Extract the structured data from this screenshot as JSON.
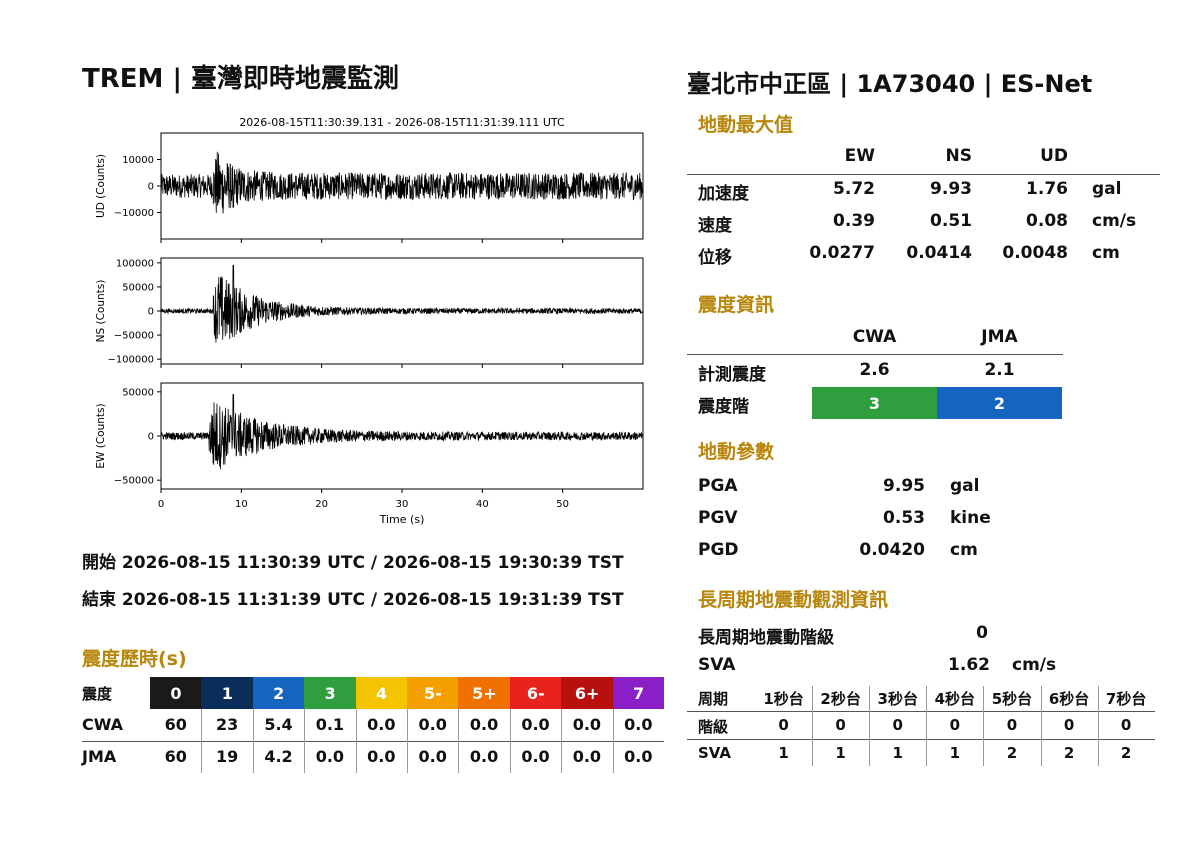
{
  "header": {
    "title": "TREM | 臺灣即時地震監測",
    "station": "臺北市中正區 | 1A73040 | ES-Net"
  },
  "chart_data": {
    "type": "line",
    "title": "2026-08-15T11:30:39.131 - 2026-08-15T11:31:39.111 UTC",
    "xlabel": "Time (s)",
    "xlim": [
      0,
      60
    ],
    "xticks": [
      0,
      10,
      20,
      30,
      40,
      50
    ],
    "series": [
      {
        "name": "UD",
        "ylabel": "UD (Counts)",
        "ylim": [
          -20000,
          20000
        ],
        "yticks": [
          10000,
          0,
          -10000
        ],
        "ytick_labels": [
          "10000",
          "0",
          "−10000"
        ],
        "peak": 16000,
        "onset": 6.5,
        "tail": 0.32,
        "decay": 0.5,
        "noise": 0.28
      },
      {
        "name": "NS",
        "ylabel": "NS (Counts)",
        "ylim": [
          -110000,
          110000
        ],
        "yticks": [
          100000,
          50000,
          0,
          -50000,
          -100000
        ],
        "ytick_labels": [
          "100000",
          "50000",
          "0",
          "−50000",
          "−100000"
        ],
        "peak": 95000,
        "onset": 6.5,
        "tail": 0.06,
        "decay": 0.22,
        "noise": 0.05
      },
      {
        "name": "EW",
        "ylabel": "EW (Counts)",
        "ylim": [
          -60000,
          60000
        ],
        "yticks": [
          50000,
          0,
          -50000
        ],
        "ytick_labels": [
          "50000",
          "0",
          "−50000"
        ],
        "peak": 47000,
        "onset": 6.0,
        "tail": 0.1,
        "decay": 0.17,
        "noise": 0.09
      }
    ]
  },
  "timing": {
    "start": "開始 2026-08-15 11:30:39 UTC / 2026-08-15 19:30:39 TST",
    "end": "結束 2026-08-15 11:31:39 UTC / 2026-08-15 19:31:39 TST"
  },
  "duration": {
    "heading": "震度歷時(s)",
    "row_label": "震度",
    "levels": [
      {
        "label": "0",
        "color": "#1a1a1a"
      },
      {
        "label": "1",
        "color": "#0a2d5a"
      },
      {
        "label": "2",
        "color": "#1565c0"
      },
      {
        "label": "3",
        "color": "#2e9e3f"
      },
      {
        "label": "4",
        "color": "#f5c400"
      },
      {
        "label": "5-",
        "color": "#f5a000"
      },
      {
        "label": "5+",
        "color": "#f07000"
      },
      {
        "label": "6-",
        "color": "#e8231e"
      },
      {
        "label": "6+",
        "color": "#b80f0f"
      },
      {
        "label": "7",
        "color": "#8b1fc7"
      }
    ],
    "rows": [
      {
        "name": "CWA",
        "values": [
          "60",
          "23",
          "5.4",
          "0.1",
          "0.0",
          "0.0",
          "0.0",
          "0.0",
          "0.0",
          "0.0"
        ]
      },
      {
        "name": "JMA",
        "values": [
          "60",
          "19",
          "4.2",
          "0.0",
          "0.0",
          "0.0",
          "0.0",
          "0.0",
          "0.0",
          "0.0"
        ]
      }
    ]
  },
  "max_motion": {
    "heading": "地動最大值",
    "columns": [
      "EW",
      "NS",
      "UD"
    ],
    "rows": [
      {
        "label": "加速度",
        "values": [
          "5.72",
          "9.93",
          "1.76"
        ],
        "unit": "gal"
      },
      {
        "label": "速度",
        "values": [
          "0.39",
          "0.51",
          "0.08"
        ],
        "unit": "cm/s"
      },
      {
        "label": "位移",
        "values": [
          "0.0277",
          "0.0414",
          "0.0048"
        ],
        "unit": "cm"
      }
    ]
  },
  "intensity": {
    "heading": "震度資訊",
    "columns": [
      "CWA",
      "JMA"
    ],
    "measured_label": "計測震度",
    "measured": [
      "2.6",
      "2.1"
    ],
    "level_label": "震度階",
    "levels": [
      "3",
      "2"
    ],
    "level_colors": [
      "#2e9e3f",
      "#1565c0"
    ]
  },
  "params": {
    "heading": "地動參數",
    "rows": [
      {
        "label": "PGA",
        "value": "9.95",
        "unit": "gal"
      },
      {
        "label": "PGV",
        "value": "0.53",
        "unit": "kine"
      },
      {
        "label": "PGD",
        "value": "0.0420",
        "unit": "cm"
      }
    ]
  },
  "long_period": {
    "heading": "長周期地震動觀測資訊",
    "class_label": "長周期地震動階級",
    "class_value": "0",
    "sva_label": "SVA",
    "sva_value": "1.62",
    "sva_unit": "cm/s",
    "table_label": "周期",
    "periods": [
      "1秒台",
      "2秒台",
      "3秒台",
      "4秒台",
      "5秒台",
      "6秒台",
      "7秒台"
    ],
    "rows": [
      {
        "label": "階級",
        "values": [
          "0",
          "0",
          "0",
          "0",
          "0",
          "0",
          "0"
        ]
      },
      {
        "label": "SVA",
        "values": [
          "1",
          "1",
          "1",
          "1",
          "2",
          "2",
          "2"
        ]
      }
    ]
  }
}
